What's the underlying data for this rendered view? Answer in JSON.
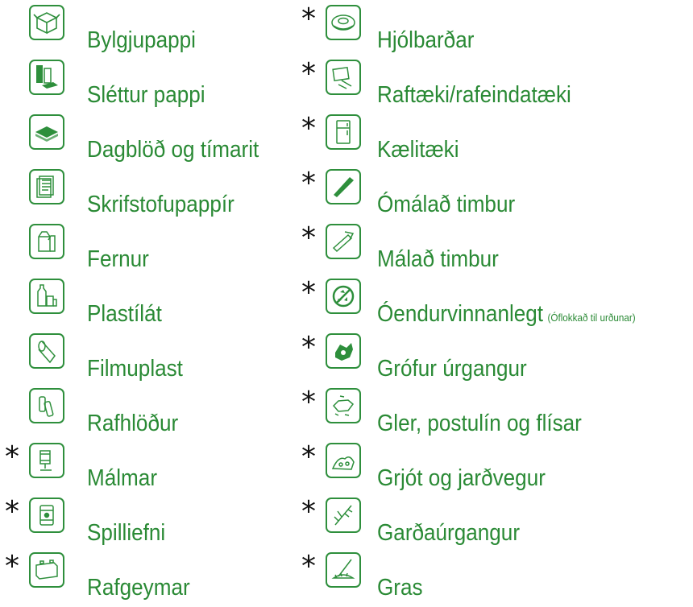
{
  "left_column": [
    {
      "asterisk": "",
      "icon": "cardboard-box-icon",
      "label": "Bylgjupappi"
    },
    {
      "asterisk": "",
      "icon": "paper-stack-icon",
      "label": "Sléttur pappi"
    },
    {
      "asterisk": "",
      "icon": "newspaper-icon",
      "label": "Dagblöð og tímarit"
    },
    {
      "asterisk": "",
      "icon": "office-paper-icon",
      "label": "Skrifstofupappír"
    },
    {
      "asterisk": "",
      "icon": "milk-carton-icon",
      "label": "Fernur"
    },
    {
      "asterisk": "",
      "icon": "plastic-bottles-icon",
      "label": "Plastílát"
    },
    {
      "asterisk": "",
      "icon": "plastic-film-icon",
      "label": "Filmuplast"
    },
    {
      "asterisk": "",
      "icon": "batteries-icon",
      "label": "Rafhlöður"
    },
    {
      "asterisk": "*",
      "icon": "metal-can-icon",
      "label": "Málmar"
    },
    {
      "asterisk": "*",
      "icon": "hazardous-barrel-icon",
      "label": "Spilliefni"
    },
    {
      "asterisk": "*",
      "icon": "car-battery-icon",
      "label": "Rafgeymar"
    }
  ],
  "right_column": [
    {
      "asterisk": "*",
      "icon": "tire-icon",
      "label": "Hjólbarðar"
    },
    {
      "asterisk": "*",
      "icon": "electronics-icon",
      "label": "Raftæki/rafeindatæki"
    },
    {
      "asterisk": "*",
      "icon": "refrigerator-icon",
      "label": "Kælitæki"
    },
    {
      "asterisk": "*",
      "icon": "wood-plank-icon",
      "label": "Ómálað timbur"
    },
    {
      "asterisk": "*",
      "icon": "painted-wood-icon",
      "label": "Málað timbur"
    },
    {
      "asterisk": "*",
      "icon": "no-recycle-icon",
      "label": "Óendurvinnanlegt",
      "note": "(Óflokkað til urðunar)"
    },
    {
      "asterisk": "*",
      "icon": "bulky-waste-icon",
      "label": "Grófur úrgangur"
    },
    {
      "asterisk": "*",
      "icon": "ceramics-icon",
      "label": "Gler, postulín og flísar"
    },
    {
      "asterisk": "*",
      "icon": "rocks-soil-icon",
      "label": "Grjót og jarðvegur"
    },
    {
      "asterisk": "*",
      "icon": "garden-waste-icon",
      "label": "Garðaúrgangur"
    },
    {
      "asterisk": "*",
      "icon": "grass-icon",
      "label": "Gras"
    }
  ],
  "colors": {
    "green": "#2a8a35",
    "icon_border": "#2e8f3c"
  }
}
